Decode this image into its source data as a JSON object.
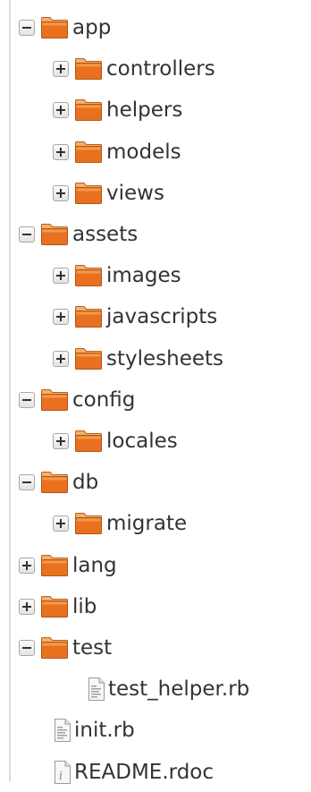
{
  "tree": {
    "items": [
      {
        "label": "app",
        "type": "folder",
        "state": "expanded",
        "depth": 0
      },
      {
        "label": "controllers",
        "type": "folder",
        "state": "collapsed",
        "depth": 1
      },
      {
        "label": "helpers",
        "type": "folder",
        "state": "collapsed",
        "depth": 1
      },
      {
        "label": "models",
        "type": "folder",
        "state": "collapsed",
        "depth": 1
      },
      {
        "label": "views",
        "type": "folder",
        "state": "collapsed",
        "depth": 1
      },
      {
        "label": "assets",
        "type": "folder",
        "state": "expanded",
        "depth": 0
      },
      {
        "label": "images",
        "type": "folder",
        "state": "collapsed",
        "depth": 1
      },
      {
        "label": "javascripts",
        "type": "folder",
        "state": "collapsed",
        "depth": 1
      },
      {
        "label": "stylesheets",
        "type": "folder",
        "state": "collapsed",
        "depth": 1
      },
      {
        "label": "config",
        "type": "folder",
        "state": "expanded",
        "depth": 0
      },
      {
        "label": "locales",
        "type": "folder",
        "state": "collapsed",
        "depth": 1
      },
      {
        "label": "db",
        "type": "folder",
        "state": "expanded",
        "depth": 0
      },
      {
        "label": "migrate",
        "type": "folder",
        "state": "collapsed",
        "depth": 1
      },
      {
        "label": "lang",
        "type": "folder",
        "state": "collapsed",
        "depth": 0
      },
      {
        "label": "lib",
        "type": "folder",
        "state": "collapsed",
        "depth": 0
      },
      {
        "label": "test",
        "type": "folder",
        "state": "expanded",
        "depth": 0
      },
      {
        "label": "test_helper.rb",
        "type": "file",
        "icon": "ruby-file-icon",
        "depth": 1
      },
      {
        "label": "init.rb",
        "type": "file",
        "icon": "ruby-file-icon",
        "depth": 0
      },
      {
        "label": "README.rdoc",
        "type": "file",
        "icon": "text-file-icon",
        "depth": 0
      }
    ]
  },
  "colors": {
    "folder_front": "#e8701e",
    "folder_back": "#f4b06a",
    "text": "#333333",
    "toggle_border": "#a8a8a8"
  }
}
